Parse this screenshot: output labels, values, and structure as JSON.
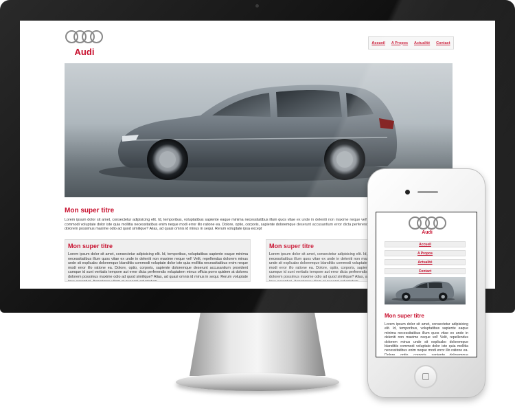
{
  "desktop": {
    "logo_text": "Audi",
    "nav": [
      "Accueil",
      "A Propos",
      "Actualité",
      "Contact"
    ],
    "main_title": "Mon super titre",
    "main_text": "Lorem ipsum dolor sit amet, consectetur adipisicing elit. Id, temporibus, voluptatibus sapiente eaque minima necessitatibus illum quos vitae ex unde in deleniti non maxime neque vel! Velit, repellendus dolorem minus dolorem blanditiis commodi voluptate dolor iste quia mollitia necessitatibus enim neque modi error illo ratione ea. Dolore, optio, corporis, sapiente doloremque deserunt accusantium error dicta perferendis voluptatem minus officia porro quidem at dolores dolorem possimus maxime odio ad quod similique? Alias, ad quasi omnis id minus in sequi. Rerum voluptate ipsa except",
    "box1_title": "Mon super titre",
    "box1_text": "Lorem ipsum dolor sit amet, consectetur adipisicing elit. Id, temporibus, voluptatibus sapiente eaque minima necessitatibus illum quos vitae ex unde in deleniti non maxime neque vel! Velit, repellendus dolorem minus unde sit explicabo doloremque blanditiis commodi voluptate dolor iste quia mollitia necessitatibus enim neque modi error illo ratione ea. Dolore, optio, corporis, sapiente doloremque deserunt accusantium provident cumque id sunt veritatis tempore aut error dicta perferendis voluptatem minus officia porro quidem at dolores dolorem possimus maxime odio ad quod similique? Alias, ad quasi omnis id minus in sequi. Rerum voluptate ipsa excepturi. Asperiores ullam et quaerat voluptatum.",
    "box2_title": "Mon super titre",
    "box2_text": "Lorem ipsum dolor sit amet, consectetur adipisicing elit. Id, temporibus, voluptatibus sapiente eaque minima necessitatibus illum quos vitae ex unde in deleniti non maxime neque vel! Velit, repellendus dolorem minus unde sit explicabo doloremque blanditiis commodi voluptate dolor iste quia mollitia necessitatibus enim neque modi error illo ratione ea. Dolore, optio, corporis, sapiente doloremque deserunt accusantium provident cumque id sunt veritatis tempore aut error dicta perferendis voluptatem minus officia porro quidem at dolores dolorem possimus maxime odio ad quod similique? Alias, ad quasi omnis id minus in sequi. Rerum voluptate ipsa excepturi. Asperiores ullam et quaerat voluptatum."
  },
  "mobile": {
    "logo_text": "Audi",
    "nav": [
      "Accueil",
      "A Propos",
      "Actualité",
      "Contact"
    ],
    "title": "Mon super titre",
    "text": "Lorem ipsum dolor sit amet, consectetur adipisicing elit. Id, temporibus, voluptatibus sapiente eaque minima necessitatibus illum quos vitae ex unde in deleniti non maxime neque vel! Velit, repellendus dolorem minus unde sit explicabo doloremque blanditiis commodi voluptate dolor iste quia mollitia necessitatibus enim neque modi error illo ratione ea. Dolore, optio, corporis, sapiente doloremque deserunt accusantium error dicta"
  },
  "colors": {
    "accent": "#c8102e",
    "bezel": "#111111",
    "box_bg": "#efefef"
  },
  "icons": [
    "audi-rings-icon",
    "phone-camera-icon",
    "home-button-icon"
  ]
}
